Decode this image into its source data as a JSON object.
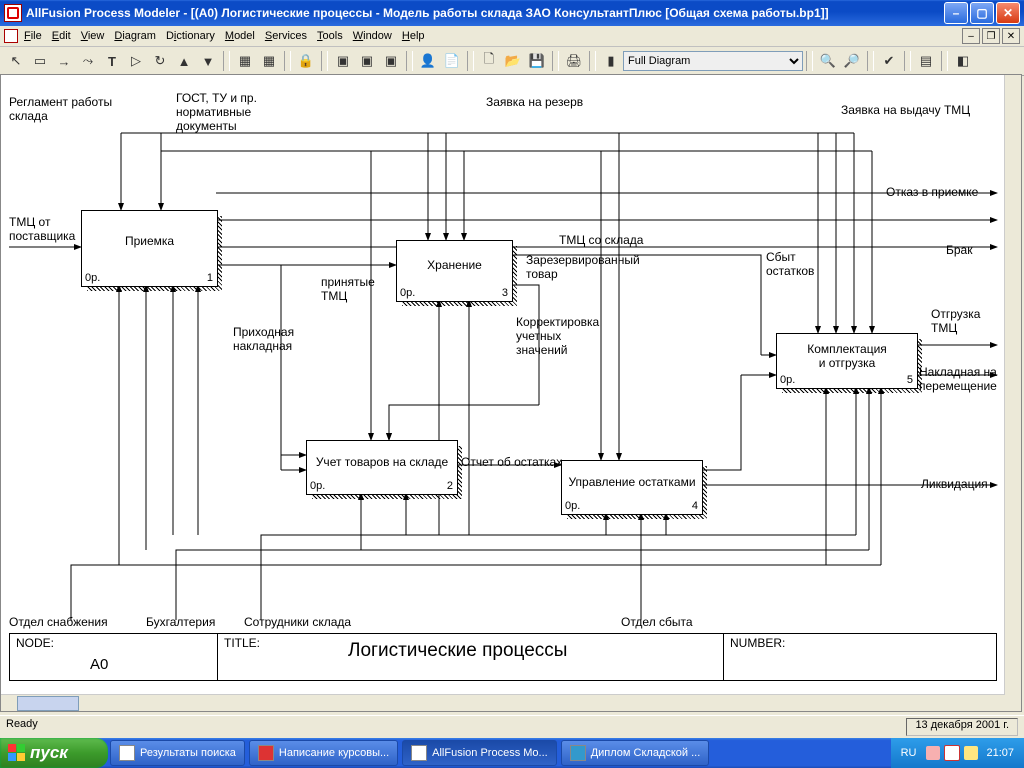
{
  "window": {
    "title": "AllFusion Process Modeler  - [(A0) Логистические процессы   - Модель работы склада ЗАО КонсультантПлюс  [Общая схема работы.bp1]]"
  },
  "menu": {
    "items": [
      "File",
      "Edit",
      "View",
      "Diagram",
      "Dictionary",
      "Model",
      "Services",
      "Tools",
      "Window",
      "Help"
    ]
  },
  "toolbar": {
    "zoomSelect": "Full Diagram"
  },
  "activities": {
    "a1": {
      "name": "Приемка",
      "bl": "0р.",
      "br": "1"
    },
    "a2": {
      "name": "Хранение",
      "bl": "0р.",
      "br": "3"
    },
    "a3": {
      "name": "Учет товаров на складе",
      "bl": "0р.",
      "br": "2"
    },
    "a4": {
      "name": "Управление остатками",
      "bl": "0р.",
      "br": "4"
    },
    "a5": {
      "name": "Комплектация\nи отгрузка",
      "bl": "0р.",
      "br": "5"
    }
  },
  "labels": {
    "reg": "Регламент работы\nсклада",
    "gost": "ГОСТ, ТУ и пр.\nнормативные\nдокументы",
    "zayres": "Заявка на резерв",
    "zayvyd": "Заявка на выдачу ТМЦ",
    "tmcpost": "ТМЦ от\nпоставщика",
    "otkaz": "Отказ в приемке",
    "brak": "Брак",
    "tmcskl": "ТМЦ со склада",
    "prin": "принятые\nТМЦ",
    "prihod": "Приходная\nнакладная",
    "zarez": "Зарезервированный\nтовар",
    "korr": "Корректировка\nучетных\nзначений",
    "otchet": "Отчет об остатках",
    "sbyt": "Сбыт\nостатков",
    "otgr": "Отгрузка\nТМЦ",
    "nakl": "Накладная на\nперемещение",
    "likv": "Ликвидация",
    "m_sn": "Отдел снабжения",
    "m_buh": "Бухгалтерия",
    "m_sotr": "Сотрудники склада",
    "m_sbyt": "Отдел сбыта"
  },
  "footer": {
    "node": "NODE:",
    "nodeval": "A0",
    "title": "TITLE:",
    "titleval": "Логистические процессы",
    "num": "NUMBER:"
  },
  "status": {
    "ready": "Ready",
    "date": "13 декабря 2001 г."
  },
  "taskbar": {
    "start": "пуск",
    "lang": "RU",
    "time": "21:07",
    "buttons": [
      "Результаты поиска",
      "Написание курсовы...",
      "AllFusion Process Mo...",
      "Диплом Складской ..."
    ]
  }
}
